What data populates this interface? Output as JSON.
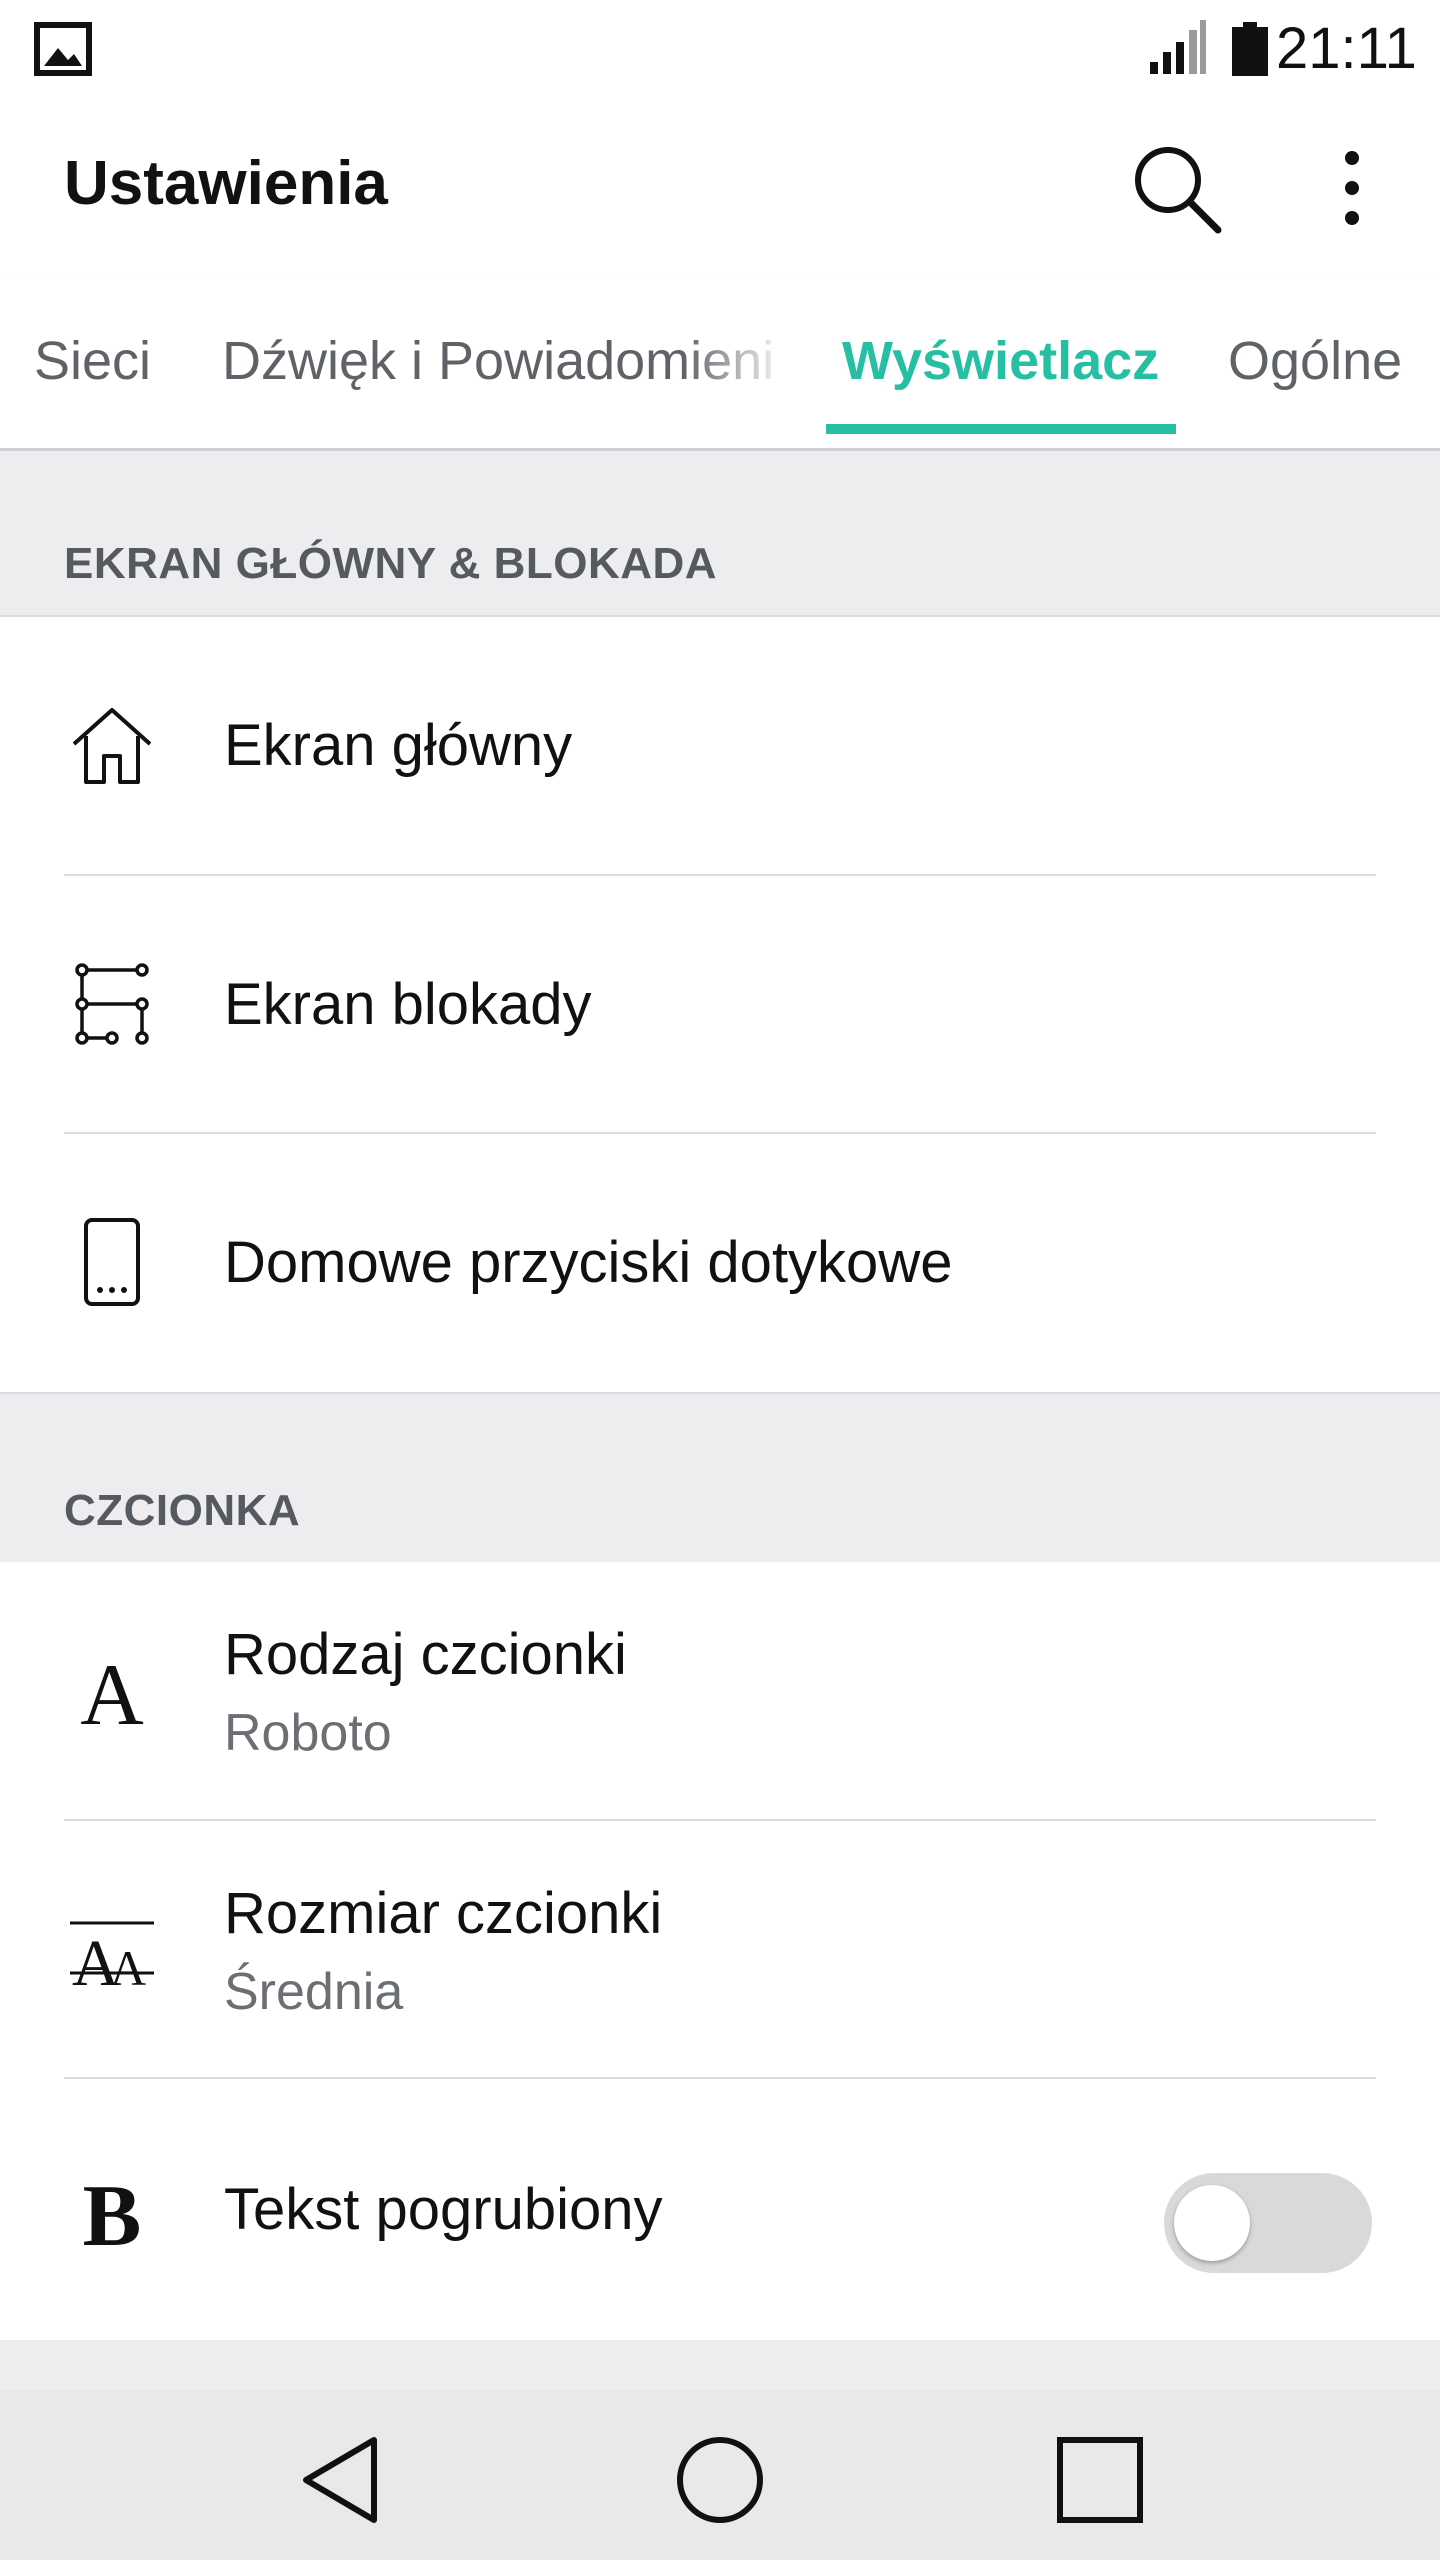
{
  "status_bar": {
    "time": "21:11",
    "notification_icon": "image-icon",
    "signal_icon": "signal-icon",
    "battery_icon": "battery-icon"
  },
  "app_bar": {
    "title": "Ustawienia",
    "search_icon": "search-icon",
    "menu_icon": "more-vert-icon"
  },
  "tabs": [
    {
      "label": "Sieci",
      "selected": false
    },
    {
      "label": "Dźwięk i Powiadomienia",
      "selected": false
    },
    {
      "label": "Wyświetlacz",
      "selected": true
    },
    {
      "label": "Ogólne",
      "selected": false
    }
  ],
  "accent_color": "#26bfa3",
  "sections": [
    {
      "header": "EKRAN GŁÓWNY & BLOKADA",
      "items": [
        {
          "icon": "home-icon",
          "title": "Ekran główny"
        },
        {
          "icon": "lock-pattern-icon",
          "title": "Ekran blokady"
        },
        {
          "icon": "phone-touch-buttons-icon",
          "title": "Domowe przyciski dotykowe"
        }
      ]
    },
    {
      "header": "CZCIONKA",
      "items": [
        {
          "icon": "font-type-icon",
          "title": "Rodzaj czcionki",
          "subtitle": "Roboto"
        },
        {
          "icon": "font-size-icon",
          "title": "Rozmiar czcionki",
          "subtitle": "Średnia"
        },
        {
          "icon": "bold-text-icon",
          "title": "Tekst pogrubiony",
          "toggle_on": false
        }
      ]
    }
  ],
  "nav_bar": {
    "back_icon": "back-icon",
    "home_icon": "home-circle-icon",
    "recents_icon": "recents-icon"
  }
}
